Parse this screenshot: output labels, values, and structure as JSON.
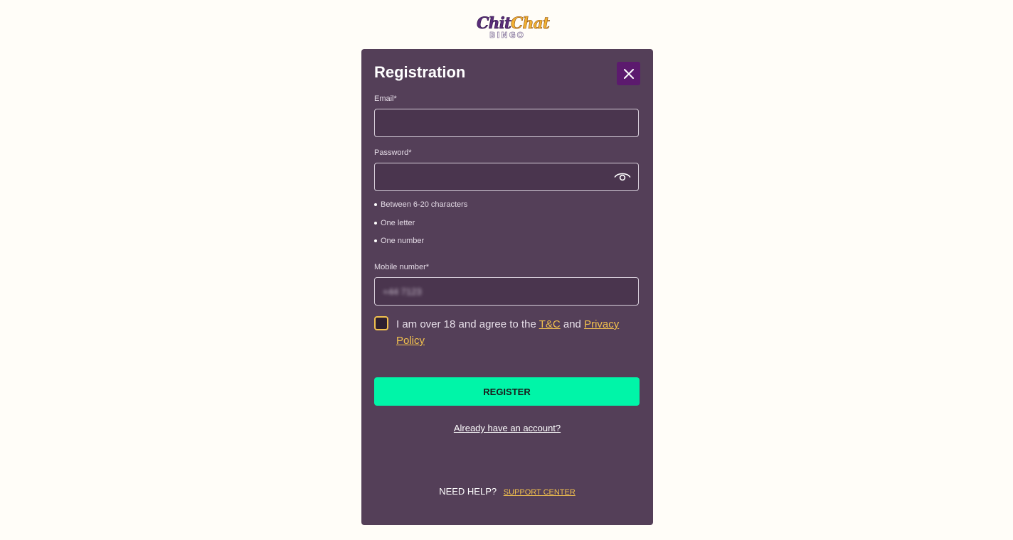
{
  "logo": {
    "word1": "Chit",
    "word2": "Chat",
    "sub": "BINGO"
  },
  "modal": {
    "title": "Registration",
    "close_icon": "close-icon"
  },
  "email": {
    "label": "Email*",
    "value": ""
  },
  "password": {
    "label": "Password*",
    "value": "",
    "toggle_icon": "eye-icon",
    "rules": [
      "Between 6-20 characters",
      "One letter",
      "One number"
    ]
  },
  "mobile": {
    "label": "Mobile number*",
    "value": "+44 7123"
  },
  "terms": {
    "checked": false,
    "prefix": "I am over 18 and agree to the ",
    "tc_link": "T&C",
    "middle": " and ",
    "privacy_link": "Privacy Policy"
  },
  "actions": {
    "register_label": "REGISTER",
    "login_link": "Already have an account?"
  },
  "help": {
    "text": "NEED HELP?",
    "link": "SUPPORT CENTER"
  },
  "colors": {
    "background": "#fffdf8",
    "modal": "#543f58",
    "accent_button": "#00f5a8",
    "link": "#f2c14e",
    "close_button": "#5c1a6e"
  }
}
